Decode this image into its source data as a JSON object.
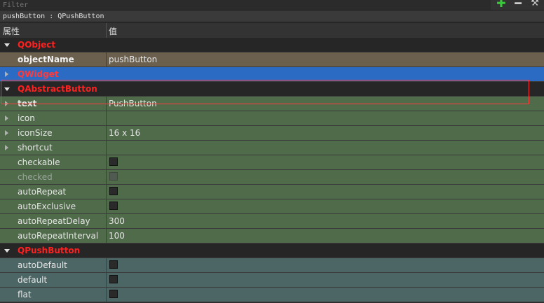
{
  "filter": {
    "placeholder": "Filter"
  },
  "toolbar": {
    "add_icon": "plus-icon",
    "remove_icon": "minus-icon",
    "config_icon": "wrench-icon"
  },
  "object_label": "pushButton : QPushButton",
  "header": {
    "property": "属性",
    "value": "值"
  },
  "rows": [
    {
      "name": "QObject"
    },
    {
      "name": "objectName",
      "value": "pushButton"
    },
    {
      "name": "QWidget"
    },
    {
      "name": "QAbstractButton"
    },
    {
      "name": "text",
      "value": "PushButton"
    },
    {
      "name": "icon",
      "value": ""
    },
    {
      "name": "iconSize",
      "value": "16 x 16"
    },
    {
      "name": "shortcut",
      "value": ""
    },
    {
      "name": "checkable"
    },
    {
      "name": "checked"
    },
    {
      "name": "autoRepeat"
    },
    {
      "name": "autoExclusive"
    },
    {
      "name": "autoRepeatDelay",
      "value": "300"
    },
    {
      "name": "autoRepeatInterval",
      "value": "100"
    },
    {
      "name": "QPushButton"
    },
    {
      "name": "autoDefault"
    },
    {
      "name": "default"
    },
    {
      "name": "flat"
    }
  ],
  "colors": {
    "category_text": "#ff2020",
    "selected_row": "#2c6bc4",
    "qobject_group": "#6b5f4d",
    "qabstractbutton_group": "#4f6b4a",
    "qpushbutton_group": "#4c6666",
    "highlight_box": "#ff3b3b"
  }
}
